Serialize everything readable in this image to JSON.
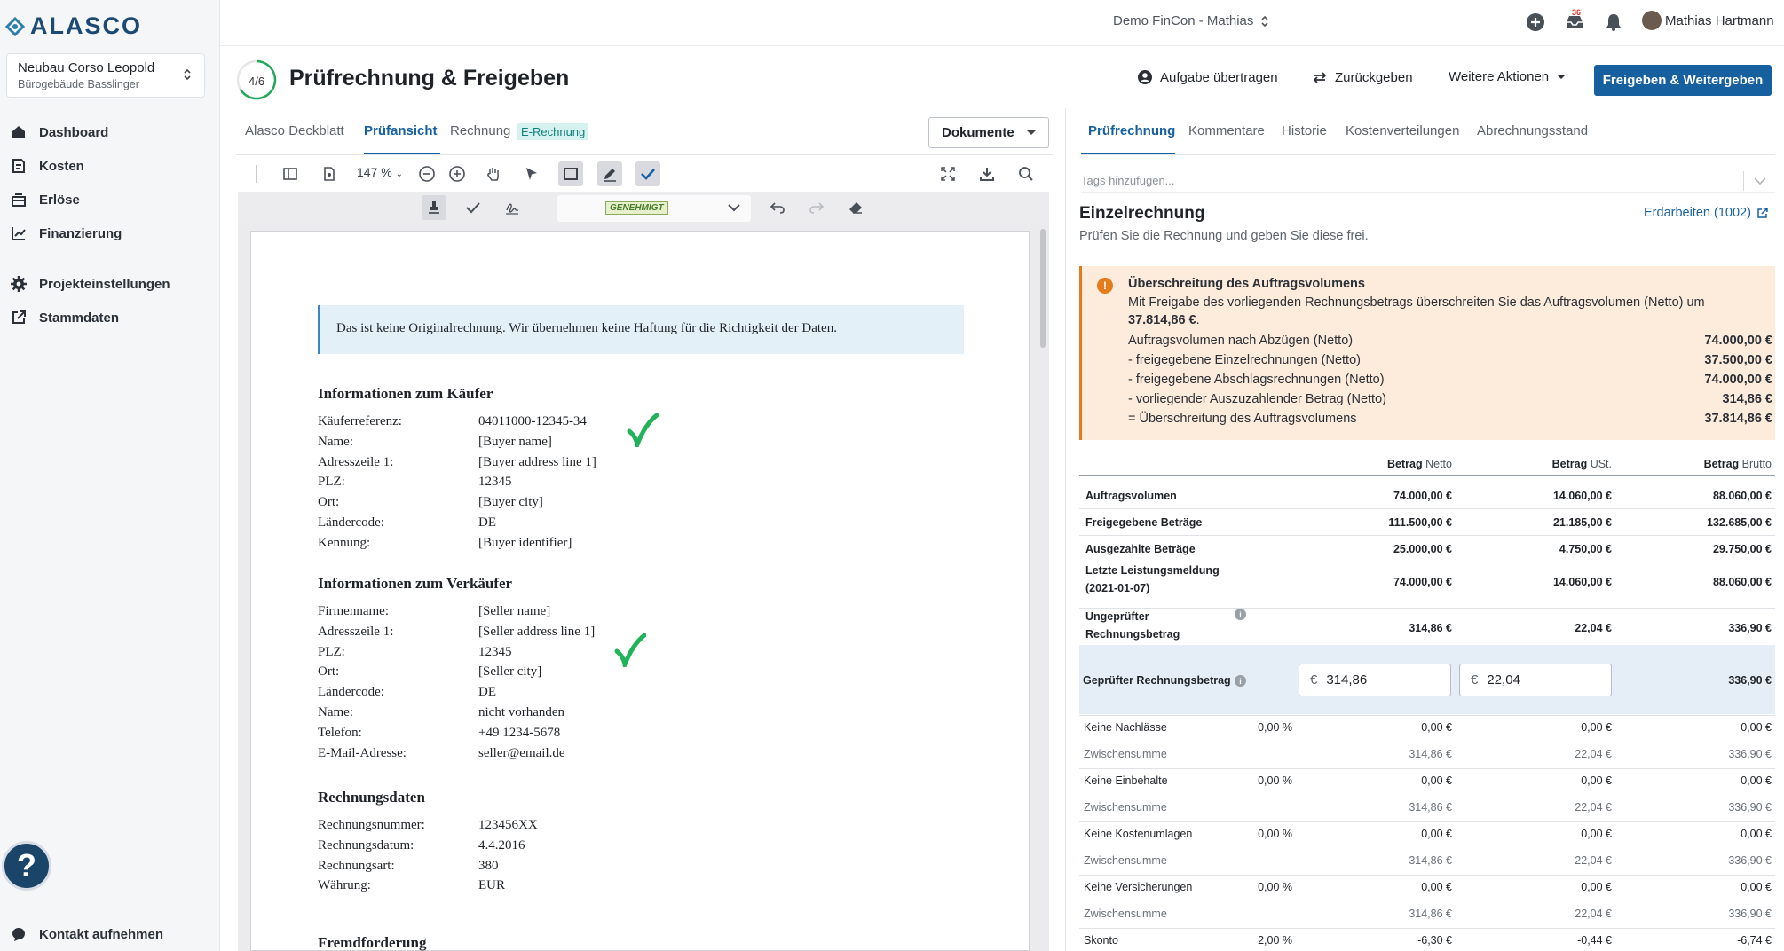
{
  "brand": {
    "logo_text": "ALASCO"
  },
  "project": {
    "name": "Neubau Corso Leopold",
    "sub": "Bürogebäude Basslinger"
  },
  "sidebar": {
    "items": [
      {
        "label": "Dashboard"
      },
      {
        "label": "Kosten"
      },
      {
        "label": "Erlöse"
      },
      {
        "label": "Finanzierung"
      },
      {
        "label": "Projekteinstellungen"
      },
      {
        "label": "Stammdaten"
      }
    ],
    "help": "?",
    "contact": "Kontakt aufnehmen"
  },
  "topbar": {
    "tenant": "Demo FinCon - Mathias",
    "inbox_count": "36",
    "user": "Mathias Hartmann"
  },
  "header": {
    "progress": "4/6",
    "title": "Prüfrechnung & Freigeben",
    "assign": "Aufgabe übertragen",
    "return": "Zurückgeben",
    "more": "Weitere Aktionen",
    "primary": "Freigeben & Weitergeben"
  },
  "left_tabs": [
    "Alasco Deckblatt",
    "Prüfansicht",
    "Rechnung",
    "E-Rechnung"
  ],
  "documents_btn": "Dokumente",
  "viewer": {
    "zoom": "147 %",
    "stamp": "GENEHMIGT",
    "notice": "Das ist keine Originalrechnung. Wir übernehmen keine Haftung für die Richtigkeit der Daten.",
    "buyer": {
      "heading": "Informationen zum Käufer",
      "rows": [
        {
          "k": "Käuferreferenz:",
          "v": "04011000-12345-34"
        },
        {
          "k": "Name:",
          "v": "[Buyer name]"
        },
        {
          "k": "Adresszeile 1:",
          "v": "[Buyer address line 1]"
        },
        {
          "k": "PLZ:",
          "v": "12345"
        },
        {
          "k": "Ort:",
          "v": "[Buyer city]"
        },
        {
          "k": "Ländercode:",
          "v": "DE"
        },
        {
          "k": "Kennung:",
          "v": "[Buyer identifier]"
        }
      ]
    },
    "seller": {
      "heading": "Informationen zum Verkäufer",
      "rows": [
        {
          "k": "Firmenname:",
          "v": "[Seller name]"
        },
        {
          "k": "Adresszeile 1:",
          "v": "[Seller address line 1]"
        },
        {
          "k": "PLZ:",
          "v": "12345"
        },
        {
          "k": "Ort:",
          "v": "[Seller city]"
        },
        {
          "k": "Ländercode:",
          "v": "DE"
        },
        {
          "k": "Name:",
          "v": "nicht vorhanden"
        },
        {
          "k": "Telefon:",
          "v": "+49 1234-5678"
        },
        {
          "k": "E-Mail-Adresse:",
          "v": "seller@email.de"
        }
      ]
    },
    "invoice": {
      "heading": "Rechnungsdaten",
      "rows": [
        {
          "k": "Rechnungsnummer:",
          "v": "123456XX"
        },
        {
          "k": "Rechnungsdatum:",
          "v": "4.4.2016"
        },
        {
          "k": "Rechnungsart:",
          "v": "380"
        },
        {
          "k": "Währung:",
          "v": "EUR"
        }
      ]
    },
    "next_heading": "Fremdforderung"
  },
  "right_tabs": [
    "Prüfrechnung",
    "Kommentare",
    "Historie",
    "Kostenverteilungen",
    "Abrechnungsstand"
  ],
  "right": {
    "tags_placeholder": "Tags hinzufügen...",
    "title": "Einzelrechnung",
    "subtitle": "Prüfen Sie die Rechnung und geben Sie diese frei.",
    "link": "Erdarbeiten (1002)",
    "warning": {
      "title": "Überschreitung des Auftragsvolumens",
      "text_a": "Mit Freigabe des vorliegenden Rechnungsbetrags überschreiten Sie das Auftragsvolumen (Netto) um",
      "text_b": "37.814,86 €",
      "text_c": ".",
      "rows": [
        {
          "k": "Auftragsvolumen nach Abzügen (Netto)",
          "v": "74.000,00 €"
        },
        {
          "k": "- freigegebene Einzelrechnungen (Netto)",
          "v": "37.500,00 €"
        },
        {
          "k": "- freigegebene Abschlagsrechnungen (Netto)",
          "v": "74.000,00 €"
        },
        {
          "k": "- vorliegender Auszuzahlender Betrag (Netto)",
          "v": "314,86 €"
        },
        {
          "k": "= Überschreitung des Auftragsvolumens",
          "v": "37.814,86 €"
        }
      ]
    },
    "table": {
      "headers": [
        {
          "b": "Betrag",
          "s": "Netto"
        },
        {
          "b": "Betrag",
          "s": "USt."
        },
        {
          "b": "Betrag",
          "s": "Brutto"
        }
      ],
      "rows": [
        {
          "label": "Auftragsvolumen",
          "n": "74.000,00 €",
          "u": "14.060,00 €",
          "b": "88.060,00 €"
        },
        {
          "label": "Freigegebene Beträge",
          "n": "111.500,00 €",
          "u": "21.185,00 €",
          "b": "132.685,00 €"
        },
        {
          "label": "Ausgezahlte Beträge",
          "n": "25.000,00 €",
          "u": "4.750,00 €",
          "b": "29.750,00 €"
        },
        {
          "label": "Letzte Leistungsmeldung",
          "label2": "(2021-01-07)",
          "n": "74.000,00 €",
          "u": "14.060,00 €",
          "b": "88.060,00 €"
        },
        {
          "label": "Ungeprüfter",
          "label2": "Rechnungsbetrag",
          "n": "314,86 €",
          "u": "22,04 €",
          "b": "336,90 €"
        }
      ],
      "geprueft": {
        "label": "Geprüfter Rechnungsbetrag",
        "net_value": "314,86",
        "vat_value": "22,04",
        "currency": "€",
        "b": "336,90 €"
      },
      "deductions": [
        {
          "label": "Keine Nachlässe",
          "pct": "0,00 %",
          "n": "0,00 €",
          "u": "0,00 €",
          "b": "0,00 €",
          "sub": "Zwischensumme",
          "sn": "314,86 €",
          "su": "22,04 €",
          "sb": "336,90 €"
        },
        {
          "label": "Keine Einbehalte",
          "pct": "0,00 %",
          "n": "0,00 €",
          "u": "0,00 €",
          "b": "0,00 €",
          "sub": "Zwischensumme",
          "sn": "314,86 €",
          "su": "22,04 €",
          "sb": "336,90 €"
        },
        {
          "label": "Keine Kostenumlagen",
          "pct": "0,00 %",
          "n": "0,00 €",
          "u": "0,00 €",
          "b": "0,00 €",
          "sub": "Zwischensumme",
          "sn": "314,86 €",
          "su": "22,04 €",
          "sb": "336,90 €"
        },
        {
          "label": "Keine Versicherungen",
          "pct": "0,00 %",
          "n": "0,00 €",
          "u": "0,00 €",
          "b": "0,00 €",
          "sub": "Zwischensumme",
          "sn": "314,86 €",
          "su": "22,04 €",
          "sb": "336,90 €"
        }
      ],
      "skonto": {
        "label": "Skonto",
        "pct": "2,00 %",
        "n": "-6,30 €",
        "u": "-0,44 €",
        "b": "-6,74 €"
      }
    }
  },
  "colors": {
    "brand": "#1d4a73",
    "primary": "#17609f",
    "warning_bg": "#fdecdc",
    "warning_accent": "#e47c1c",
    "check": "#22b35a"
  }
}
